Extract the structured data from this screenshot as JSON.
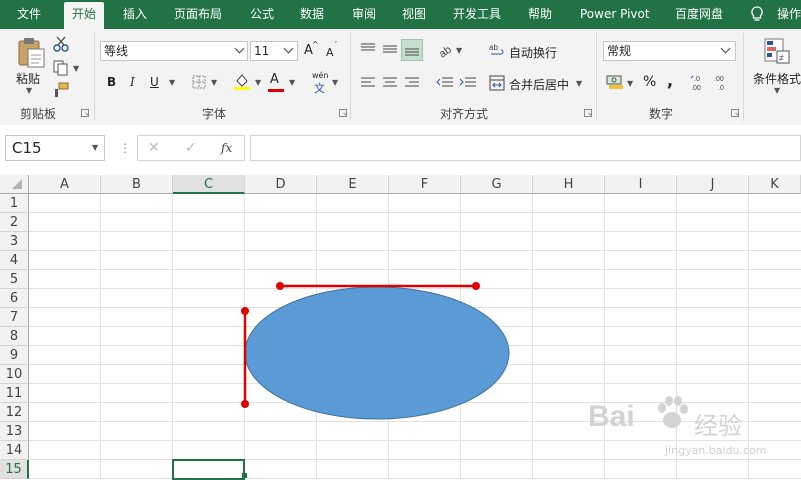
{
  "menu": {
    "file": "文件",
    "tabs": [
      "开始",
      "插入",
      "页面布局",
      "公式",
      "数据",
      "审阅",
      "视图",
      "开发工具",
      "帮助",
      "Power Pivot",
      "百度网盘"
    ],
    "tell_me": "操作"
  },
  "ribbon": {
    "clipboard": {
      "paste": "粘贴",
      "label": "剪贴板"
    },
    "font": {
      "name": "等线",
      "size": "11",
      "grow": "A",
      "shrink": "A",
      "bold": "B",
      "italic": "I",
      "underline": "U",
      "font_color_letter": "A",
      "phonetic": "wén",
      "phonetic_sub": "文",
      "label": "字体"
    },
    "alignment": {
      "wrap": "自动换行",
      "merge": "合并后居中",
      "label": "对齐方式"
    },
    "number": {
      "format": "常规",
      "percent": "%",
      "comma": ",",
      "label": "数字"
    },
    "styles": {
      "conditional": "条件格式"
    }
  },
  "formula_bar": {
    "name_box": "C15",
    "fx": "fx",
    "cancel": "✕",
    "enter": "✓",
    "value": ""
  },
  "sheet": {
    "columns": [
      "A",
      "B",
      "C",
      "D",
      "E",
      "F",
      "G",
      "H",
      "I",
      "J",
      "K"
    ],
    "rows": [
      "1",
      "2",
      "3",
      "4",
      "5",
      "6",
      "7",
      "8",
      "9",
      "10",
      "11",
      "12",
      "13",
      "14",
      "15"
    ],
    "active_cell": "C15",
    "selected_column": "C",
    "selected_row": "15"
  },
  "shapes": {
    "ellipse_fill": "#5b9bd5",
    "ellipse_stroke": "#41719c",
    "marker_color": "#e00000"
  },
  "watermark": {
    "brand": "Bai",
    "brand2": "经验",
    "url": "jingyan.baidu.com"
  },
  "colors": {
    "accent": "#217346",
    "ribbon_bg": "#f3f3f3",
    "grid": "#e1e1e1"
  }
}
